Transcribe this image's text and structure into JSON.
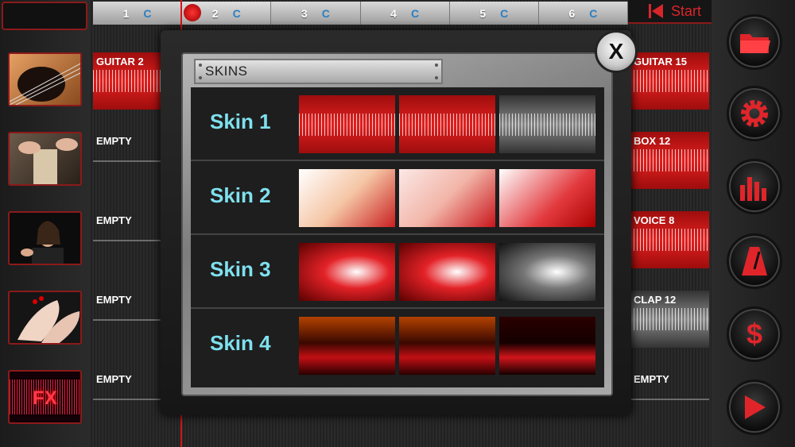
{
  "tabs": [
    {
      "num": "1",
      "c": "C"
    },
    {
      "num": "2",
      "c": "C"
    },
    {
      "num": "3",
      "c": "C"
    },
    {
      "num": "4",
      "c": "C"
    },
    {
      "num": "5",
      "c": "C"
    },
    {
      "num": "6",
      "c": "C"
    }
  ],
  "start_label": "Start",
  "left_tracks": [
    "GUITAR 2",
    "EMPTY",
    "EMPTY",
    "EMPTY",
    "EMPTY"
  ],
  "right_tracks": [
    "GUITAR 15",
    "BOX 12",
    "VOICE 8",
    "CLAP 12",
    "EMPTY"
  ],
  "modal": {
    "title": "SKINS",
    "close_label": "X",
    "skins": [
      "Skin 1",
      "Skin 2",
      "Skin 3",
      "Skin 4"
    ]
  },
  "thumb_fx": "FX",
  "right_buttons": [
    "folder-icon",
    "gear-icon",
    "mixer-icon",
    "metronome-icon",
    "dollar-icon",
    "play-icon"
  ],
  "colors": {
    "accent_red": "#d4151a",
    "skin_label": "#7fe0ee",
    "tab_c": "#2a7fc2"
  }
}
